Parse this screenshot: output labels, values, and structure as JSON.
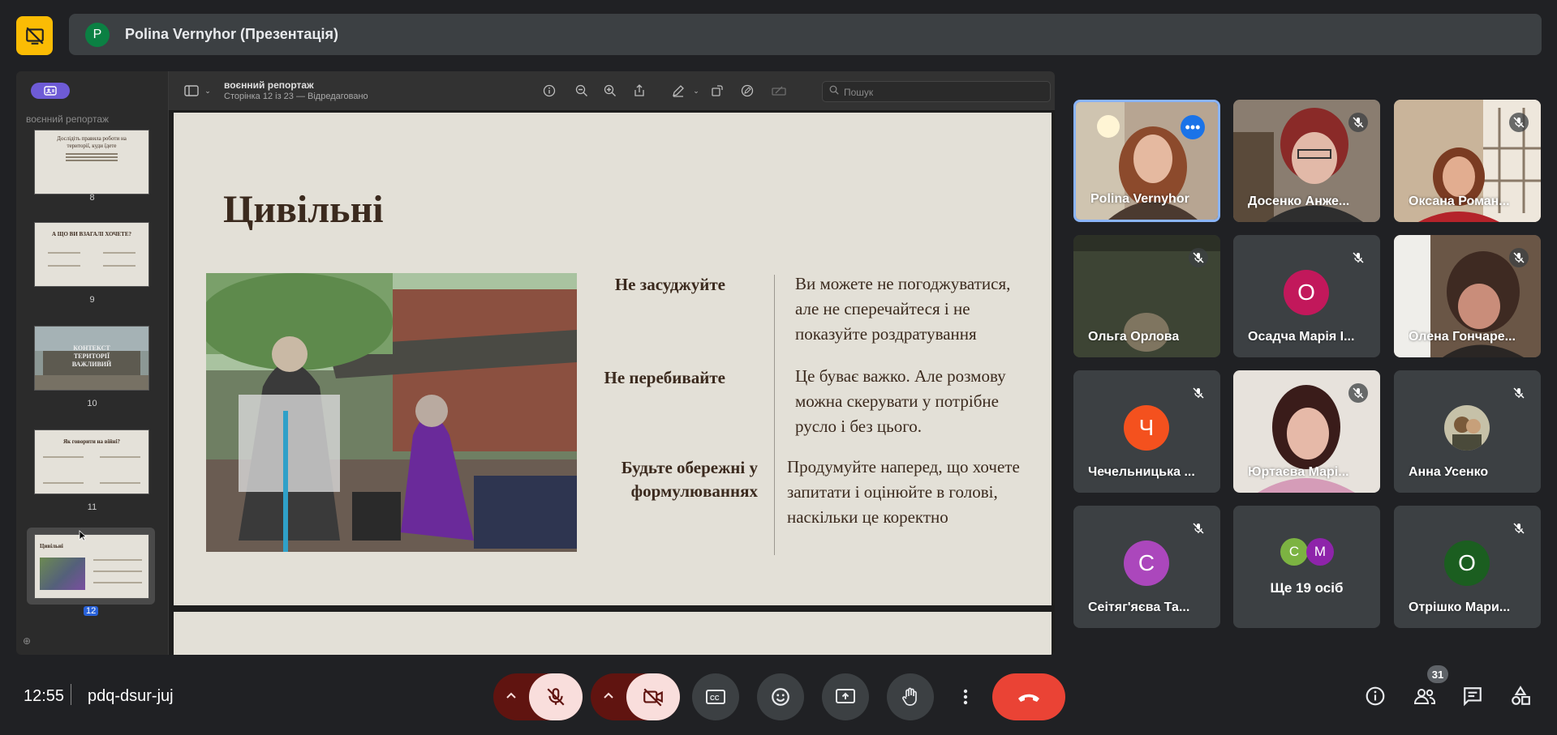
{
  "header": {
    "presenter_initial": "P",
    "presenter_title": "Polina Vernyhor (Презентація)"
  },
  "viewer": {
    "sidebar_title": "воєнний репортаж",
    "doc_title": "воєнний репортаж",
    "doc_status": "Сторінка 12 із 23 — Відредаговано",
    "search_placeholder": "Пошук",
    "thumbnails": [
      {
        "num": "8",
        "heading": "Дослідіть правила роботи на території, куди їдете"
      },
      {
        "num": "9",
        "heading": "А ЩО ВИ ВЗАГАЛІ ХОЧЕТЕ?"
      },
      {
        "num": "10",
        "heading": "КОНТЕКСТ ТЕРИТОРІЇ ВАЖЛИВИЙ"
      },
      {
        "num": "11",
        "heading": "Як говорити на війні?"
      },
      {
        "num": "12",
        "heading": "Цивільні"
      }
    ]
  },
  "slide": {
    "title": "Цивільні",
    "rules": [
      {
        "label": "Не засуджуйте",
        "text": "Ви можете не погоджуватися, але не сперечайтеся і не показуйте роздратування"
      },
      {
        "label": "Не перебивайте",
        "text": "Це буває важко. Але розмову можна скерувати у потрібне русло і без цього."
      },
      {
        "label": "Будьте обережні у формулюваннях",
        "text": "Продумуйте наперед, що хочете запитати і оцінюйте в голові, наскільки це коректно"
      }
    ]
  },
  "participants": [
    {
      "name": "Polina Vernyhor"
    },
    {
      "name": "Досенко Анже..."
    },
    {
      "name": "Оксана Роман..."
    },
    {
      "name": "Ольга Орлова"
    },
    {
      "name": "Осадча Марія І...",
      "initial": "О",
      "color": "#c2185b"
    },
    {
      "name": "Олена Гончаре..."
    },
    {
      "name": "Чечельницька ...",
      "initial": "Ч",
      "color": "#f4511e"
    },
    {
      "name": "Юртаєва Марі..."
    },
    {
      "name": "Анна Усенко"
    },
    {
      "name": "Сеітяг'яєва Та...",
      "initial": "С",
      "color": "#ab47bc"
    },
    {
      "name": "Ще 19 осіб",
      "initials": [
        "С",
        "М"
      ],
      "colors": [
        "#7cb342",
        "#8e24aa"
      ]
    },
    {
      "name": "Отрішко Мари...",
      "initial": "О",
      "color": "#1b5e20"
    }
  ],
  "bottom": {
    "time": "12:55",
    "meeting_code": "pdq-dsur-juj",
    "people_count": "31"
  }
}
